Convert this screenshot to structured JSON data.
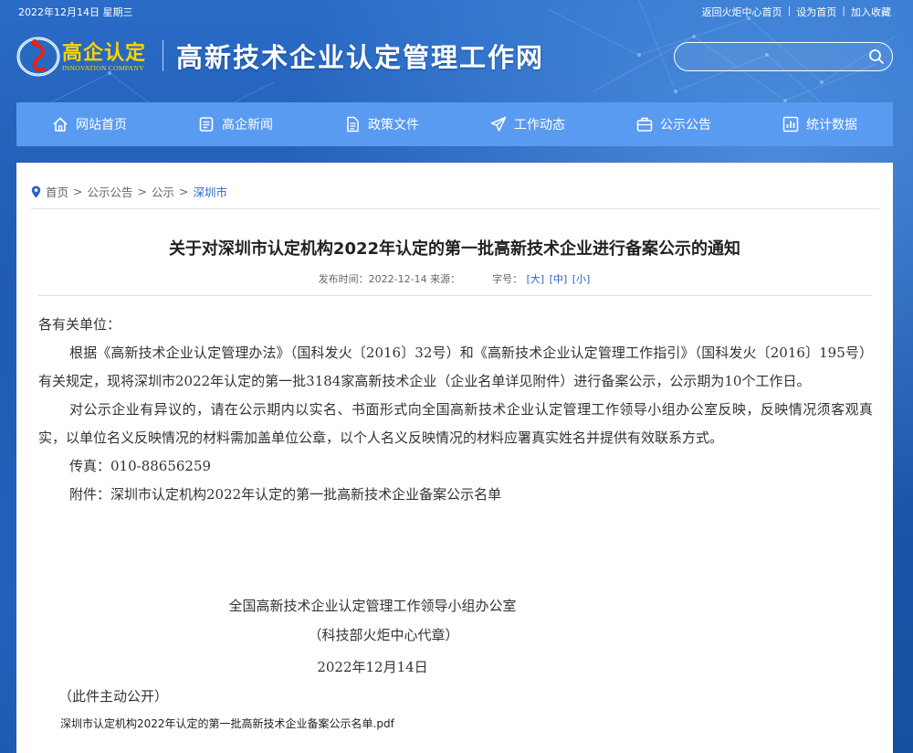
{
  "topbar": {
    "date": "2022年12月14日 星期三",
    "links": [
      "返回火炬中心首页",
      "设为首页",
      "加入收藏"
    ]
  },
  "header": {
    "logo_cn": "高企认定",
    "logo_en": "INNOVATION COMPANY",
    "site_title": "高新技术企业认定管理工作网",
    "search_placeholder": ""
  },
  "nav": {
    "items": [
      {
        "label": "网站首页",
        "icon": "home-icon"
      },
      {
        "label": "高企新闻",
        "icon": "news-icon"
      },
      {
        "label": "政策文件",
        "icon": "document-icon"
      },
      {
        "label": "工作动态",
        "icon": "send-icon"
      },
      {
        "label": "公示公告",
        "icon": "briefcase-icon"
      },
      {
        "label": "统计数据",
        "icon": "chart-icon"
      }
    ]
  },
  "breadcrumb": {
    "items": [
      "首页",
      "公示公告",
      "公示"
    ],
    "current": "深圳市"
  },
  "article": {
    "title": "关于对深圳市认定机构2022年认定的第一批高新技术企业进行备案公示的通知",
    "meta_prefix": "发布时间：2022-12-14 来源：",
    "font_label": "字号：",
    "font_sizes": [
      "[大]",
      "[中]",
      "[小]"
    ],
    "salutation": "各有关单位：",
    "para1": "根据《高新技术企业认定管理办法》（国科发火〔2016〕32号）和《高新技术企业认定管理工作指引》（国科发火〔2016〕195号）有关规定，现将深圳市2022年认定的第一批3184家高新技术企业（企业名单详见附件）进行备案公示，公示期为10个工作日。",
    "para2": "对公示企业有异议的，请在公示期内以实名、书面形式向全国高新技术企业认定管理工作领导小组办公室反映，反映情况须客观真实，以单位名义反映情况的材料需加盖单位公章，以个人名义反映情况的材料应署真实姓名并提供有效联系方式。",
    "fax": "传真：010-88656259",
    "attachment_line": "附件：深圳市认定机构2022年认定的第一批高新技术企业备案公示名单",
    "signature_org": "全国高新技术企业认定管理工作领导小组办公室",
    "signature_seal": "（科技部火炬中心代章）",
    "signature_date": "2022年12月14日",
    "public_note": "（此件主动公开）",
    "attachment_file": "深圳市认定机构2022年认定的第一批高新技术企业备案公示名单.pdf"
  },
  "colors": {
    "background": "#1f5fb5",
    "nav": "#5a9bf2",
    "logo": "#ffd200",
    "breadcrumb_current": "#2b64c5"
  }
}
